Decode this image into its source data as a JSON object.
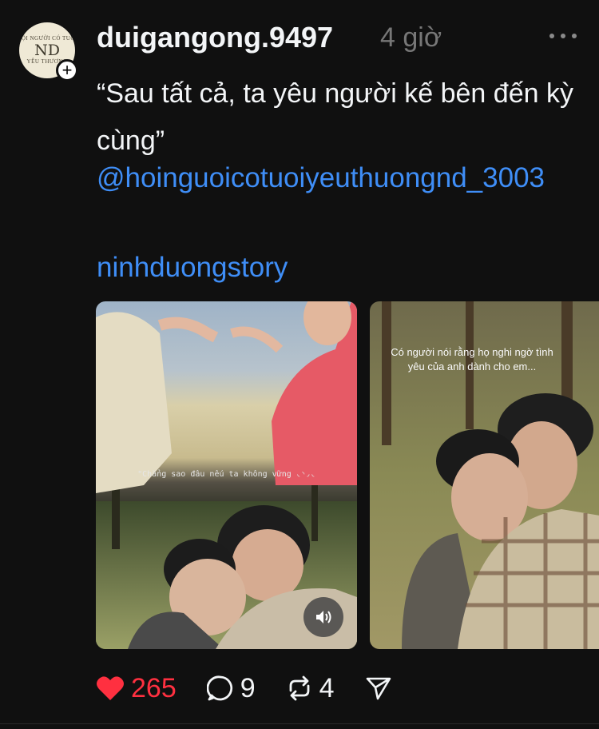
{
  "post": {
    "username": "duigangong.9497",
    "timestamp": "4 giờ",
    "text": "“Sau tất cả, ta yêu người kế bên đến kỳ cùng”",
    "mention": "@hoinguoicotuoiyeuthuongnd_3003",
    "tag": "ninhduongstory"
  },
  "avatar": {
    "top_text": "HỘI NGƯỜI CÓ TUỔI",
    "mid_text": "YÊU THƯƠNG",
    "monogram": "ND"
  },
  "media": [
    {
      "caption": "\"Chẳng sao đâu nếu ta không vững ◟◝◞◟",
      "has_sound_button": true
    },
    {
      "caption": "Có người nói rằng họ nghi ngờ tình yêu của anh dành cho em..."
    }
  ],
  "actions": {
    "likes": "265",
    "comments": "9",
    "reposts": "4"
  },
  "colors": {
    "background": "#101010",
    "link": "#3f8ef7",
    "like": "#ff3040",
    "muted": "#777777"
  }
}
